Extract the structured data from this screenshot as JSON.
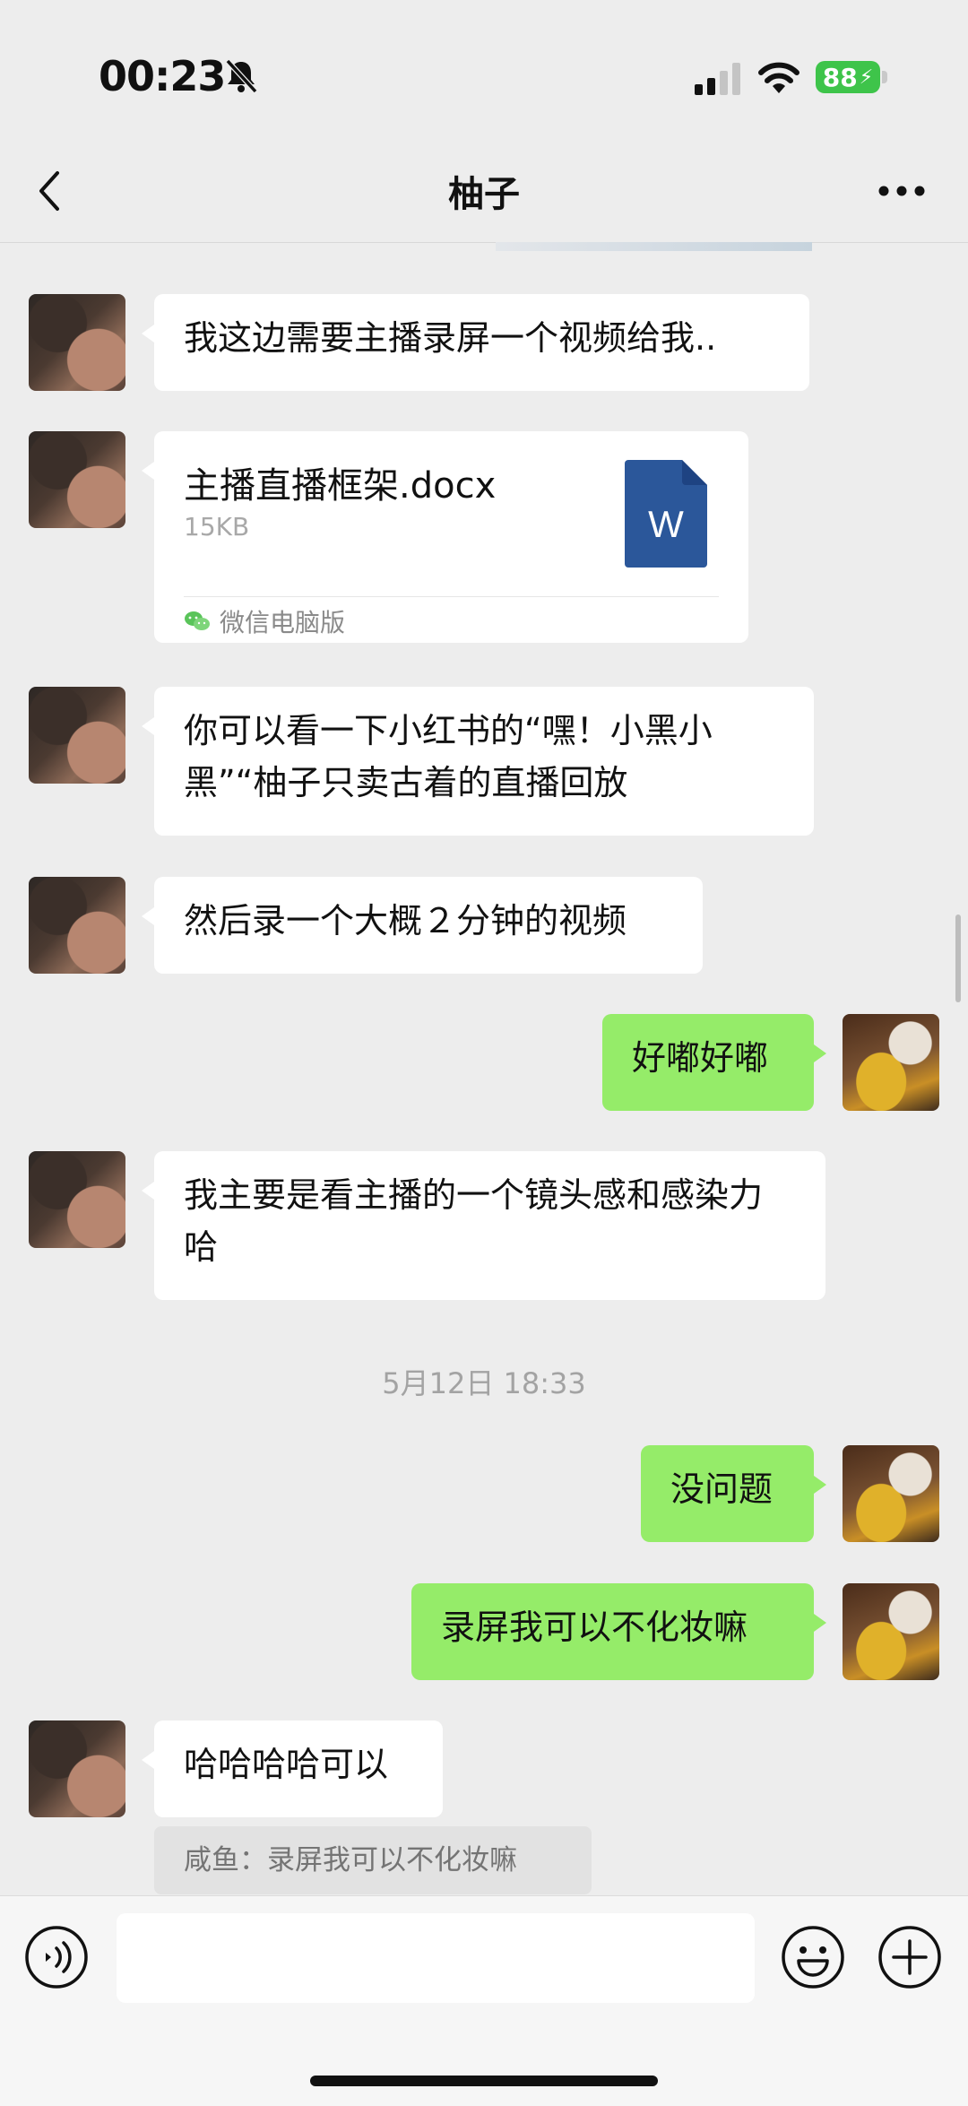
{
  "status_bar": {
    "time": "00:23",
    "battery": "88"
  },
  "header": {
    "title": "柚子"
  },
  "messages": [
    {
      "side": "left",
      "text": "我这边需要主播录屏一个视频给我.."
    },
    {
      "side": "left",
      "type": "file",
      "file_name": "主播直播框架.docx",
      "file_size": "15KB",
      "source": "微信电脑版",
      "icon_letter": "W"
    },
    {
      "side": "left",
      "text": "你可以看一下小红书的“嘿！小黑小黑”“柚子只卖古着的直播回放"
    },
    {
      "side": "left",
      "text": "然后录一个大概２分钟的视频"
    },
    {
      "side": "right",
      "text": "好嘟好嘟"
    },
    {
      "side": "left",
      "text": "我主要是看主播的一个镜头感和感染力哈"
    },
    {
      "side": "right",
      "text": "没问题"
    },
    {
      "side": "right",
      "text": "录屏我可以不化妆嘛"
    },
    {
      "side": "left",
      "text": "哈哈哈哈可以",
      "quote": "咸鱼：录屏我可以不化妆嘛"
    }
  ],
  "timestamp": "5月12日 18:33",
  "input": {
    "value": "",
    "placeholder": ""
  },
  "icons": {
    "back": "chevron-left-icon",
    "more": "more-dots-icon",
    "voice": "voice-icon",
    "emoji": "emoji-icon",
    "plus": "plus-icon",
    "word": "word-doc-icon",
    "wechat": "wechat-icon"
  },
  "colors": {
    "background": "#ededed",
    "bubble_self": "#95ec69",
    "bubble_other": "#ffffff",
    "word_blue": "#2b579a",
    "battery_green": "#3ec44a"
  }
}
